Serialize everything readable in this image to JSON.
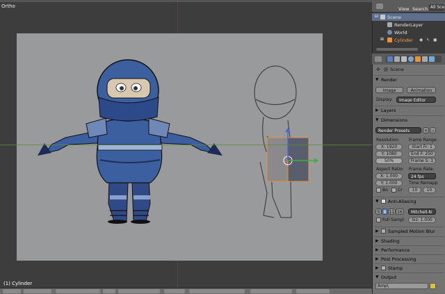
{
  "viewport": {
    "view_label": "Ortho",
    "object_label": "(1) Cylinder"
  },
  "outliner": {
    "header": {
      "view": "View",
      "search": "Search",
      "scenes": "All Sce"
    },
    "items": [
      {
        "label": "Scene"
      },
      {
        "label": "RenderLayer"
      },
      {
        "label": "World"
      },
      {
        "label": "Cylinder"
      }
    ]
  },
  "properties": {
    "scene_label": "Scene",
    "render": {
      "title": "Render",
      "image_button": "Image",
      "animation_button": "Animation",
      "display_label": "Display:",
      "display_value": "Image Editor"
    },
    "layers": {
      "title": "Layers"
    },
    "dimensions": {
      "title": "Dimensions",
      "presets": "Render Presets",
      "resolution_label": "Resolution:",
      "res_x": "X: 1920",
      "res_y": "Y: 1080",
      "res_pct": "50%",
      "frame_range_label": "Frame Range:",
      "start": "Start Fr: 1",
      "end": "End F: 250",
      "step": "Frame S: 1",
      "aspect_label": "Aspect Ratio:",
      "aspect_x": "X: 1.000",
      "aspect_y": "Y: 1.000",
      "frame_rate_label": "Frame Rate:",
      "fps": "24 fps",
      "time_remap_label": "Time Remapp",
      "remap_old": "10",
      "remap_new": "10",
      "border_label": "Bo",
      "crop_label": "Cr"
    },
    "anti_aliasing": {
      "title": "Anti-Aliasing",
      "samples": [
        "5",
        "8",
        "11",
        "16"
      ],
      "filter": "Mitchell-N",
      "full_sample": "Full Sampl",
      "size": "Siz: 1.000"
    },
    "sampled_motion_blur": {
      "title": "Sampled Motion Blur"
    },
    "shading": {
      "title": "Shading"
    },
    "performance": {
      "title": "Performance"
    },
    "post_processing": {
      "title": "Post Processing"
    },
    "stamp": {
      "title": "Stamp"
    },
    "output": {
      "title": "Output",
      "path": "Amp\\"
    }
  },
  "colors": {
    "accent_blue": "#5680c2",
    "active_orange": "#e8913a",
    "axis_green": "#3fae3f",
    "axis_blue": "#4a6ad8"
  }
}
